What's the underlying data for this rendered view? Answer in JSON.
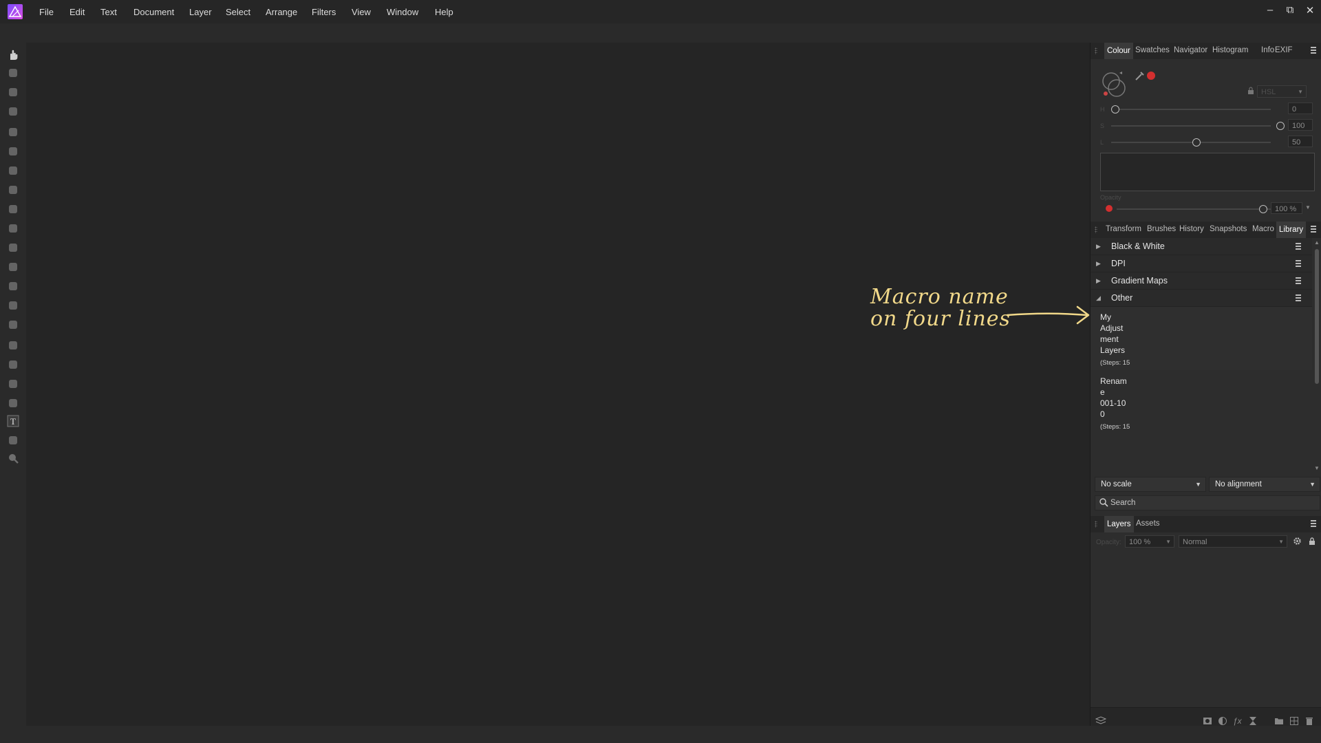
{
  "menu": {
    "items": [
      "File",
      "Edit",
      "Text",
      "Document",
      "Layer",
      "Select",
      "Arrange",
      "Filters",
      "View",
      "Window",
      "Help"
    ]
  },
  "window": {
    "minimize": "–",
    "restore": "⧉",
    "close": "✕"
  },
  "tools": [
    "view-tool-icon",
    "move-tool-icon",
    "color-picker-icon",
    "crop-tool-icon",
    "selection-brush-icon",
    "flood-select-icon",
    "marquee-icon",
    "freehand-select-icon",
    "paint-brush-icon",
    "pixel-tool-icon",
    "paint-mixer-icon",
    "erase-brush-icon",
    "fill-tool-icon",
    "clone-brush-icon",
    "retouch-icon",
    "dodge-icon",
    "smudge-icon",
    "pen-tool-icon",
    "shape-tool-icon",
    "text-tool-icon",
    "mesh-warp-icon",
    "zoom-tool-icon"
  ],
  "colour_panel": {
    "tabs": [
      "Colour",
      "Swatches",
      "Navigator",
      "Histogram",
      "Info",
      "EXIF"
    ],
    "active_tab": "Colour",
    "model": "HSL",
    "h_label": "H",
    "s_label": "S",
    "l_label": "L",
    "h_value": "0",
    "s_value": "100",
    "l_value": "50",
    "h_level": 0,
    "s_level": 1.0,
    "l_level": 0.5,
    "opacity_label": "Opacity",
    "opacity_value": "100 %",
    "opacity_level": 1.0,
    "accent_color": "#d32f2f"
  },
  "library_panel": {
    "tabs": [
      "Transform",
      "Brushes",
      "History",
      "Snapshots",
      "Macro",
      "Library"
    ],
    "active_tab": "Library",
    "categories": [
      "Black & White",
      "DPI",
      "Gradient Maps",
      "Other"
    ],
    "macros": [
      {
        "name_lines": [
          "My",
          "Adjust",
          "ment",
          "Layers"
        ],
        "steps": "(Steps: 15"
      },
      {
        "name_lines": [
          "Renam",
          "e",
          "001-10",
          "0"
        ],
        "steps": "(Steps: 15"
      }
    ],
    "scale_option": "No scale",
    "alignment_option": "No alignment",
    "search_placeholder": "Search"
  },
  "layers_panel": {
    "tabs": [
      "Layers",
      "Assets"
    ],
    "active_tab": "Layers",
    "opacity_label": "Opacity:",
    "opacity_value": "100 %",
    "blend_mode": "Normal"
  },
  "annotation": {
    "line1": "Macro name",
    "line2": "on four lines",
    "color": "#f2d98a"
  }
}
